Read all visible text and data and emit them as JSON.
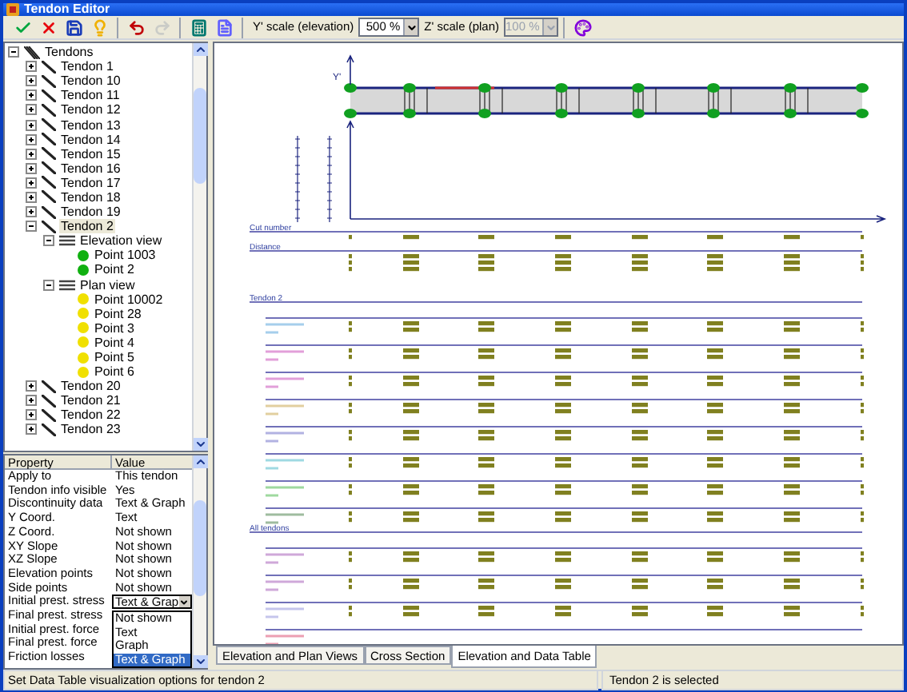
{
  "window": {
    "title": "Tendon Editor"
  },
  "toolbar": {
    "buttons": [
      {
        "kind": "accept",
        "disabled": false
      },
      {
        "kind": "cancel",
        "disabled": false
      },
      {
        "kind": "save",
        "disabled": false
      },
      {
        "kind": "hint",
        "disabled": false
      },
      {
        "kind": "undo",
        "disabled": false
      },
      {
        "kind": "redo",
        "disabled": true
      },
      {
        "kind": "calculator",
        "disabled": false
      },
      {
        "kind": "report",
        "disabled": false
      }
    ],
    "y_scale": {
      "label": "Y' scale (elevation)",
      "value": "500 %",
      "disabled": false
    },
    "z_scale": {
      "label": "Z' scale (plan)",
      "value": "100 %",
      "disabled": true
    },
    "end_buttons": [
      {
        "kind": "palette",
        "disabled": false
      }
    ]
  },
  "tree": {
    "label": "Tendons",
    "kind": "group",
    "expanded": true,
    "selected": false,
    "children": [
      {
        "label": "Tendon 1",
        "kind": "tendon",
        "expanded": false,
        "selected": false
      },
      {
        "label": "Tendon 10",
        "kind": "tendon",
        "expanded": false,
        "selected": false
      },
      {
        "label": "Tendon 11",
        "kind": "tendon",
        "expanded": false,
        "selected": false
      },
      {
        "label": "Tendon 12",
        "kind": "tendon",
        "expanded": false,
        "selected": false
      },
      {
        "label": "Tendon 13",
        "kind": "tendon",
        "expanded": false,
        "selected": false
      },
      {
        "label": "Tendon 14",
        "kind": "tendon",
        "expanded": false,
        "selected": false
      },
      {
        "label": "Tendon 15",
        "kind": "tendon",
        "expanded": false,
        "selected": false
      },
      {
        "label": "Tendon 16",
        "kind": "tendon",
        "expanded": false,
        "selected": false
      },
      {
        "label": "Tendon 17",
        "kind": "tendon",
        "expanded": false,
        "selected": false
      },
      {
        "label": "Tendon 18",
        "kind": "tendon",
        "expanded": false,
        "selected": false
      },
      {
        "label": "Tendon 19",
        "kind": "tendon",
        "expanded": false,
        "selected": false
      },
      {
        "label": "Tendon 2",
        "kind": "tendon",
        "expanded": true,
        "selected": true,
        "children": [
          {
            "label": "Elevation view",
            "kind": "view",
            "expanded": true,
            "selected": false,
            "children": [
              {
                "label": "Point 1003",
                "kind": "point",
                "color": "#10b010",
                "selected": false
              },
              {
                "label": "Point 2",
                "kind": "point",
                "color": "#10b010",
                "selected": false
              }
            ]
          },
          {
            "label": "Plan view",
            "kind": "view",
            "expanded": true,
            "selected": false,
            "children": [
              {
                "label": "Point 10002",
                "kind": "point",
                "color": "#f0e000",
                "selected": false
              },
              {
                "label": "Point 28",
                "kind": "point",
                "color": "#f0e000",
                "selected": false
              },
              {
                "label": "Point 3",
                "kind": "point",
                "color": "#f0e000",
                "selected": false
              },
              {
                "label": "Point 4",
                "kind": "point",
                "color": "#f0e000",
                "selected": false
              },
              {
                "label": "Point 5",
                "kind": "point",
                "color": "#f0e000",
                "selected": false
              },
              {
                "label": "Point 6",
                "kind": "point",
                "color": "#f0e000",
                "selected": false
              }
            ]
          }
        ]
      },
      {
        "label": "Tendon 20",
        "kind": "tendon",
        "expanded": false,
        "selected": false
      },
      {
        "label": "Tendon 21",
        "kind": "tendon",
        "expanded": false,
        "selected": false
      },
      {
        "label": "Tendon 22",
        "kind": "tendon",
        "expanded": false,
        "selected": false
      },
      {
        "label": "Tendon 23",
        "kind": "tendon",
        "expanded": false,
        "selected": false
      }
    ]
  },
  "property_grid": {
    "columns": [
      "Property",
      "Value"
    ],
    "rows": [
      {
        "property": "Apply to",
        "value": "This tendon",
        "kind": "text"
      },
      {
        "property": "Tendon info visible",
        "value": "Yes",
        "kind": "text"
      },
      {
        "property": "Discontinuity data",
        "value": "Text & Graph",
        "kind": "text"
      },
      {
        "property": "Y Coord.",
        "value": "Text",
        "kind": "text"
      },
      {
        "property": "Z Coord.",
        "value": "Not shown",
        "kind": "text"
      },
      {
        "property": "XY Slope",
        "value": "Not shown",
        "kind": "text"
      },
      {
        "property": "XZ Slope",
        "value": "Not shown",
        "kind": "text"
      },
      {
        "property": "Elevation points",
        "value": "Not shown",
        "kind": "text"
      },
      {
        "property": "Side points",
        "value": "Not shown",
        "kind": "text"
      },
      {
        "property": "Initial prest. stress",
        "value": "Text & Grap",
        "kind": "dropdown",
        "options": [
          {
            "label": "Not shown",
            "selected": false
          },
          {
            "label": "Text",
            "selected": false
          },
          {
            "label": "Graph",
            "selected": false
          },
          {
            "label": "Text & Graph",
            "selected": true
          }
        ]
      },
      {
        "property": "Final prest. stress",
        "kind": "text"
      },
      {
        "property": "Initial prest. force",
        "kind": "text"
      },
      {
        "property": "Final prest. force",
        "kind": "text"
      },
      {
        "property": "Friction losses",
        "kind": "text"
      }
    ]
  },
  "drawing": {
    "axis_label": "Y'",
    "table_sections": [
      {
        "label": "Cut number"
      },
      {
        "label": "Distance"
      },
      {
        "label": "Tendon 2"
      },
      {
        "label": "All tendons"
      }
    ]
  },
  "tabs": [
    {
      "label": "Elevation and Plan Views",
      "selected": false
    },
    {
      "label": "Cross Section",
      "selected": false
    },
    {
      "label": "Elevation and Data Table",
      "selected": true
    }
  ],
  "status_bar": [
    "Set Data Table visualization options for tendon 2",
    "Tendon 2 is selected"
  ]
}
